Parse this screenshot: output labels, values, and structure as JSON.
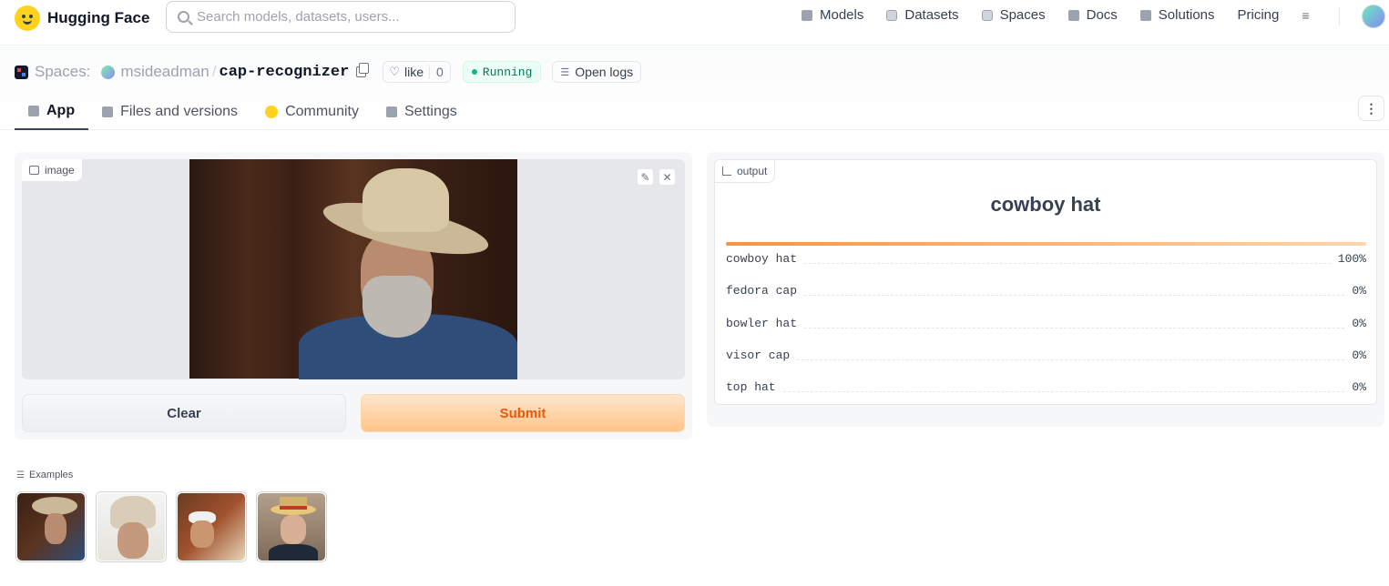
{
  "brand": {
    "name": "Hugging Face"
  },
  "search": {
    "placeholder": "Search models, datasets, users..."
  },
  "nav": {
    "links": [
      "Models",
      "Datasets",
      "Spaces",
      "Docs",
      "Solutions",
      "Pricing"
    ]
  },
  "space": {
    "prefix": "Spaces:",
    "owner": "msideadman",
    "separator": "/",
    "name": "cap-recognizer",
    "like_label": "like",
    "like_count": "0",
    "status": "Running",
    "logs_label": "Open logs"
  },
  "tabs": [
    {
      "label": "App"
    },
    {
      "label": "Files and versions"
    },
    {
      "label": "Community"
    },
    {
      "label": "Settings"
    }
  ],
  "input": {
    "label": "image",
    "clear_label": "Clear",
    "submit_label": "Submit"
  },
  "output": {
    "label": "output",
    "top_label": "cowboy hat",
    "top_confidence": 1.0,
    "rows": [
      {
        "label": "cowboy hat",
        "value": "100%"
      },
      {
        "label": "fedora cap",
        "value": "0%"
      },
      {
        "label": "bowler hat",
        "value": "0%"
      },
      {
        "label": "visor cap",
        "value": "0%"
      },
      {
        "label": "top hat",
        "value": "0%"
      }
    ]
  },
  "examples": {
    "label": "Examples",
    "count": 4
  },
  "colors": {
    "accent_orange": "#ea580c",
    "status_green": "#047857"
  }
}
